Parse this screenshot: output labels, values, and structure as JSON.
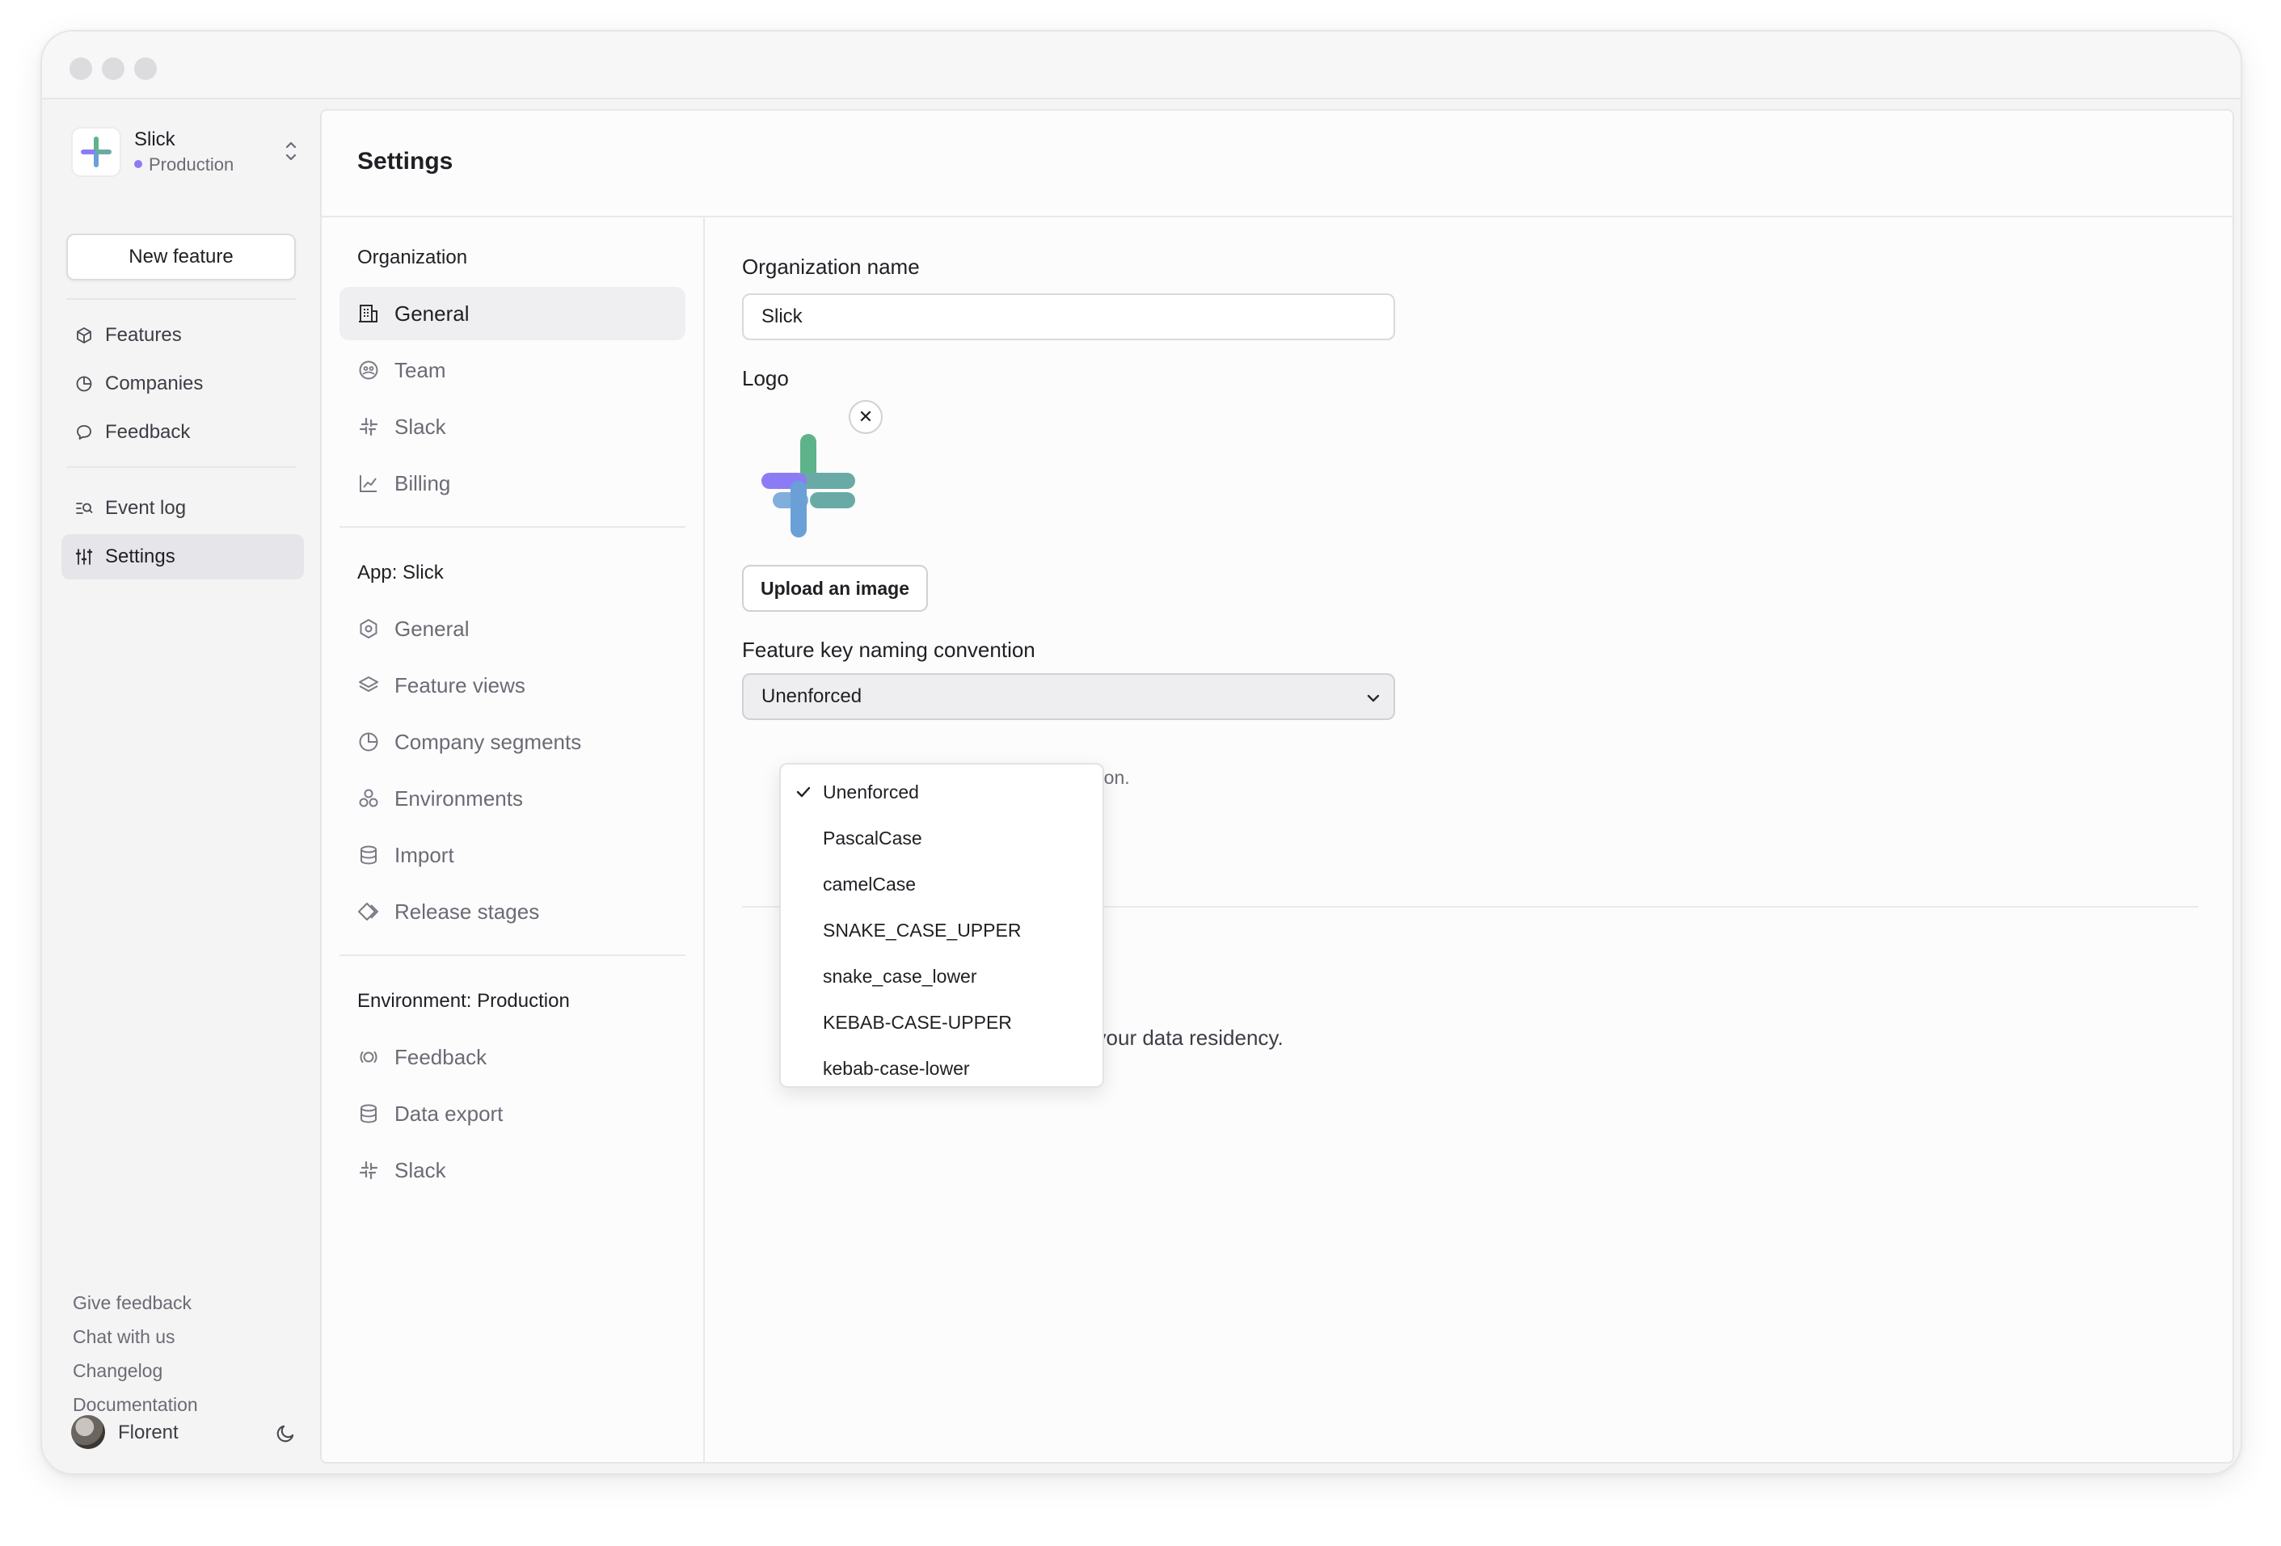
{
  "sidebar": {
    "org_name": "Slick",
    "org_env": "Production",
    "new_feature_label": "New feature",
    "nav": [
      {
        "label": "Features",
        "icon": "box-icon"
      },
      {
        "label": "Companies",
        "icon": "pie-chart-icon"
      },
      {
        "label": "Feedback",
        "icon": "message-icon"
      },
      {
        "label": "Event log",
        "icon": "log-search-icon"
      },
      {
        "label": "Settings",
        "icon": "sliders-icon",
        "active": true
      }
    ],
    "footer_links": [
      "Give feedback",
      "Chat with us",
      "Changelog",
      "Documentation"
    ],
    "user_name": "Florent"
  },
  "main": {
    "title": "Settings",
    "sections": [
      {
        "heading": "Organization",
        "items": [
          {
            "label": "General",
            "icon": "building-icon",
            "active": true
          },
          {
            "label": "Team",
            "icon": "team-icon"
          },
          {
            "label": "Slack",
            "icon": "slack-icon"
          },
          {
            "label": "Billing",
            "icon": "chart-line-icon"
          }
        ]
      },
      {
        "heading": "App: Slick",
        "items": [
          {
            "label": "General",
            "icon": "hexagon-icon"
          },
          {
            "label": "Feature views",
            "icon": "layers-icon"
          },
          {
            "label": "Company segments",
            "icon": "pie-chart-icon"
          },
          {
            "label": "Environments",
            "icon": "shapes-icon"
          },
          {
            "label": "Import",
            "icon": "database-icon"
          },
          {
            "label": "Release stages",
            "icon": "diamond-icon"
          }
        ]
      },
      {
        "heading": "Environment: Production",
        "items": [
          {
            "label": "Feedback",
            "icon": "broadcast-icon"
          },
          {
            "label": "Data export",
            "icon": "database-icon"
          },
          {
            "label": "Slack",
            "icon": "slack-icon"
          }
        ]
      }
    ]
  },
  "form": {
    "org_name_label": "Organization name",
    "org_name_value": "Slick",
    "logo_label": "Logo",
    "remove_label": "✕",
    "upload_label": "Upload an image",
    "naming_label": "Feature key naming convention",
    "naming_value": "Unenforced",
    "helper_tail": "convention.",
    "residency_tail": "hange your data residency.",
    "options": [
      "Unenforced",
      "PascalCase",
      "camelCase",
      "SNAKE_CASE_UPPER",
      "snake_case_lower",
      "KEBAB-CASE-UPPER",
      "kebab-case-lower"
    ],
    "selected_option": "Unenforced"
  },
  "colors": {
    "logo_purple": "#8b7cf6",
    "logo_green": "#5fb38a",
    "logo_blue": "#6ba0d6",
    "logo_teal": "#6aaaa6"
  }
}
